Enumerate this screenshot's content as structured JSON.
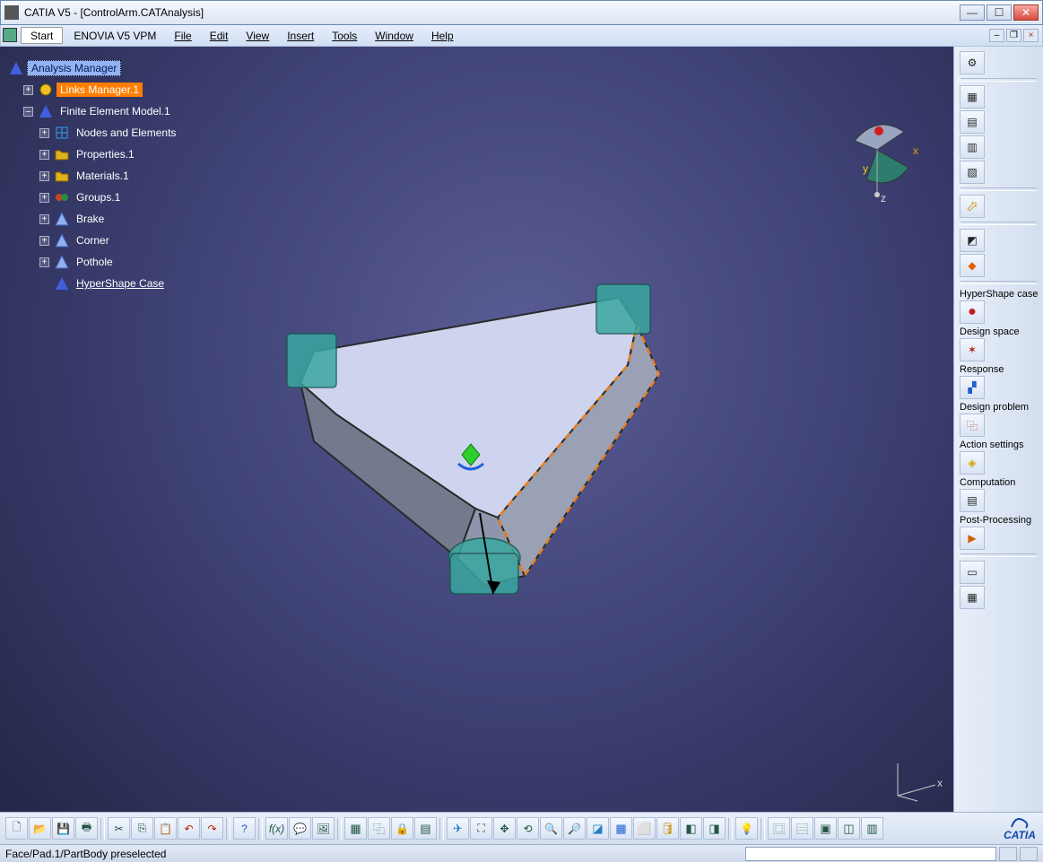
{
  "title": "CATIA V5 - [ControlArm.CATAnalysis]",
  "menu": {
    "start": "Start",
    "enovia": "ENOVIA V5 VPM",
    "file": "File",
    "edit": "Edit",
    "view": "View",
    "insert": "Insert",
    "tools": "Tools",
    "window": "Window",
    "help": "Help"
  },
  "tree": {
    "root": "Analysis Manager",
    "links": "Links Manager.1",
    "fem": "Finite Element Model.1",
    "nodes": "Nodes and Elements",
    "properties": "Properties.1",
    "materials": "Materials.1",
    "groups": "Groups.1",
    "brake": "Brake",
    "corner": "Corner",
    "pothole": "Pothole",
    "hypershape": "HyperShape Case"
  },
  "sidebar": {
    "s1": "HyperShape case",
    "s2": "Design space",
    "s3": "Response",
    "s4": "Design problem",
    "s5": "Action settings",
    "s6": "Computation",
    "s7": "Post-Processing"
  },
  "status": "Face/Pad.1/PartBody preselected",
  "logo": "CATIA",
  "compass": {
    "x": "x",
    "y": "y",
    "z": "z"
  },
  "icons": {
    "min": "—",
    "max": "☐",
    "close": "✕"
  }
}
